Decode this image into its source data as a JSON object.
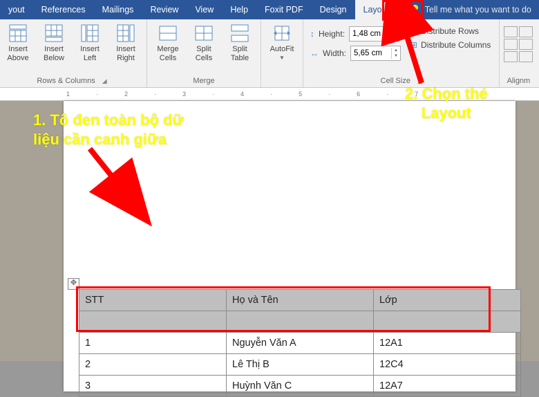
{
  "tabs": {
    "items": [
      "yout",
      "References",
      "Mailings",
      "Review",
      "View",
      "Help",
      "Foxit PDF",
      "Design",
      "Layout"
    ],
    "tell_me": "Tell me what you want to do"
  },
  "ribbon": {
    "rows_cols": {
      "insert_above": "Insert\nAbove",
      "insert_below": "Insert\nBelow",
      "insert_left": "Insert\nLeft",
      "insert_right": "Insert\nRight",
      "label": "Rows & Columns"
    },
    "merge": {
      "merge_cells": "Merge\nCells",
      "split_cells": "Split\nCells",
      "split_table": "Split\nTable",
      "label": "Merge"
    },
    "autofit": "AutoFit",
    "cell_size": {
      "height_lbl": "Height:",
      "height_val": "1,48 cm",
      "width_lbl": "Width:",
      "width_val": "5,65 cm",
      "dist_rows": "Distribute Rows",
      "dist_cols": "Distribute Columns",
      "label": "Cell Size"
    },
    "align_label": "Alignm"
  },
  "annotations": {
    "step1": "1. Tô đen toàn bộ dữ\nliệu cần canh giữa",
    "step2": "2. Chọn thẻ\nLayout"
  },
  "table": {
    "headers": [
      "STT",
      "Họ và Tên",
      "Lớp"
    ],
    "rows": [
      [
        "1",
        "Nguyễn Văn A",
        "12A1"
      ],
      [
        "2",
        "Lê Thị B",
        "12C4"
      ],
      [
        "3",
        "Huỳnh Văn C",
        "12A7"
      ]
    ]
  }
}
